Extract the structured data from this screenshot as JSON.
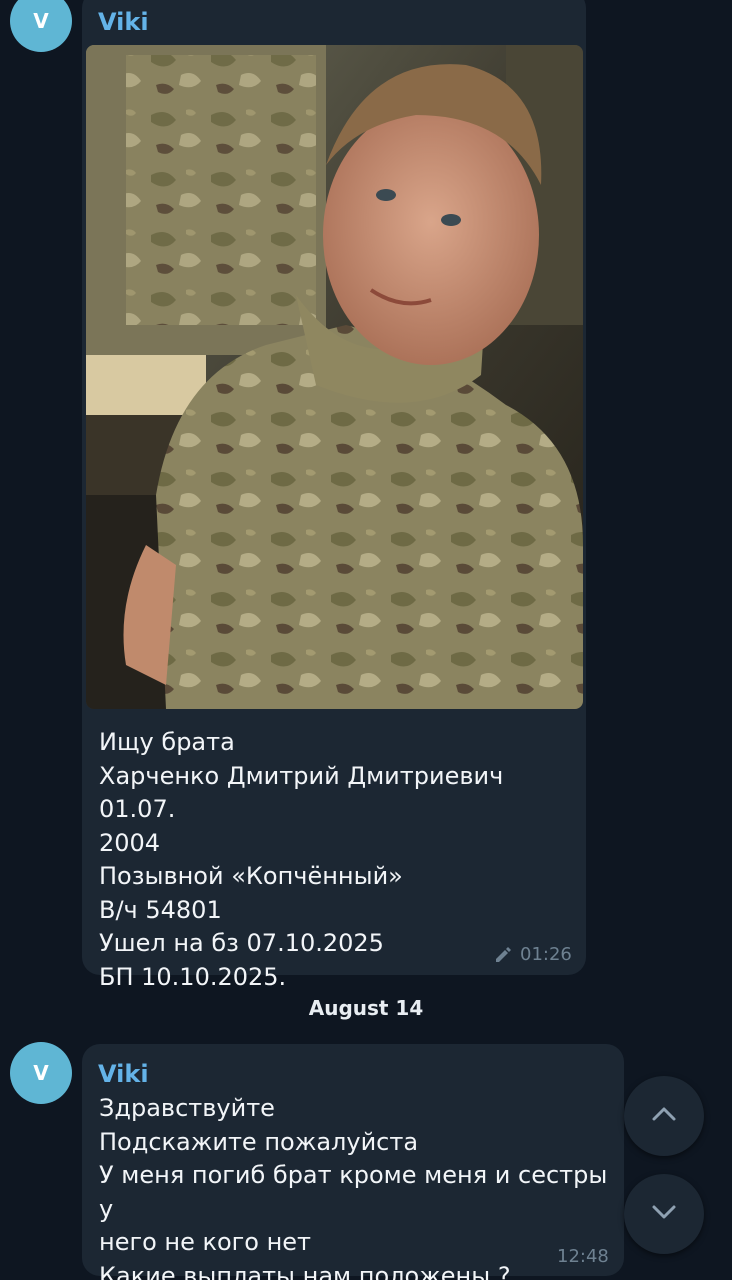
{
  "messages": [
    {
      "avatar_letter": "V",
      "sender": "Viki",
      "text": "Ищу брата\nХарченко Дмитрий Дмитриевич 01.07.\n2004\nПозывной «Копчённый»\nВ/ч 54801\nУшел на бз 07.10.2025\nБП 10.10.2025.",
      "time": "01:26",
      "edited_icon": "pencil-icon"
    },
    {
      "avatar_letter": "V",
      "sender": "Viki",
      "text": "Здравствуйте\nПодскажите пожалуйста\nУ меня погиб брат кроме меня и сестры у\nнего не кого нет\nКакие выплаты нам положены ?",
      "time": "12:48"
    }
  ],
  "date_separator": "August 14",
  "buttons": {
    "scroll_up_icon": "chevron-up-icon",
    "scroll_down_icon": "chevron-down-icon"
  },
  "colors": {
    "background": "#0e1621",
    "bubble": "#1c2733",
    "sender_name": "#64b3e8",
    "avatar": "#5fb6d4"
  }
}
